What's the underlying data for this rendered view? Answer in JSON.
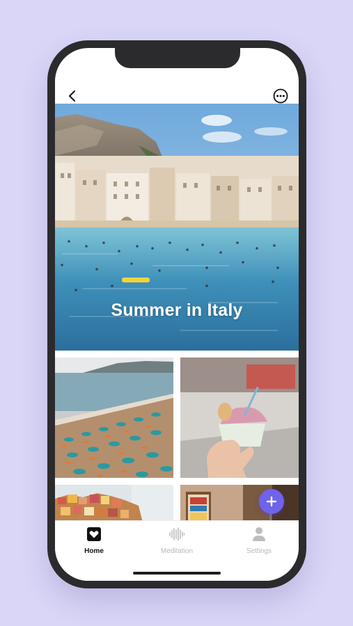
{
  "hero": {
    "title": "Summer in Italy"
  },
  "tabs": [
    {
      "label": "Home",
      "icon": "heart-icon",
      "active": true
    },
    {
      "label": "Meditation",
      "icon": "soundwave-icon",
      "active": false
    },
    {
      "label": "Settings",
      "icon": "person-icon",
      "active": false
    }
  ],
  "fab": {
    "icon": "plus-icon"
  },
  "colors": {
    "accent": "#6e63ea",
    "background": "#d9d6f7",
    "frame": "#2b2b2e"
  }
}
